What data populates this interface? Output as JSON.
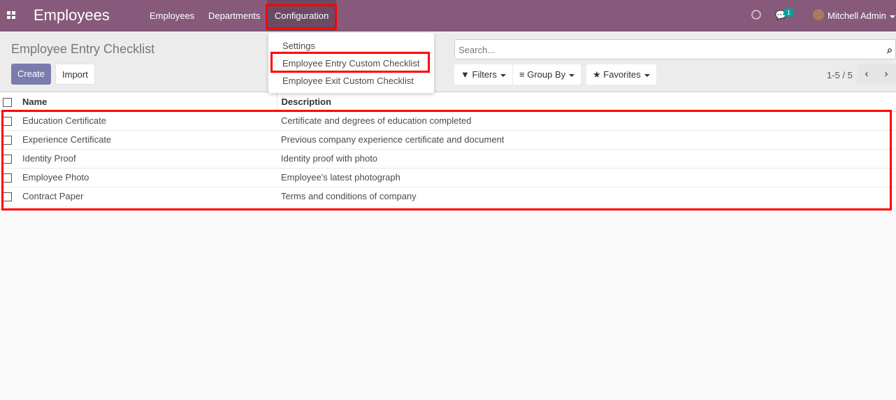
{
  "nav": {
    "brand": "Employees",
    "menus": [
      "Employees",
      "Departments",
      "Configuration"
    ],
    "chat_badge": "1",
    "user": "Mitchell Admin"
  },
  "dropdown": [
    "Settings",
    "Employee Entry Custom Checklist",
    "Employee Exit Custom Checklist"
  ],
  "control": {
    "title": "Employee Entry Checklist",
    "create": "Create",
    "import": "Import",
    "search_placeholder": "Search...",
    "filters": "Filters",
    "group_by": "Group By",
    "favorites": "Favorites",
    "pager": "1-5 / 5"
  },
  "table": {
    "headers": [
      "Name",
      "Description"
    ],
    "rows": [
      [
        "Education Certificate",
        "Certificate and degrees of education completed"
      ],
      [
        "Experience Certificate",
        "Previous company experience certificate and document"
      ],
      [
        "Identity Proof",
        "Identity proof with photo"
      ],
      [
        "Employee Photo",
        "Employee's latest photograph"
      ],
      [
        "Contract Paper",
        "Terms and conditions of company"
      ]
    ]
  }
}
